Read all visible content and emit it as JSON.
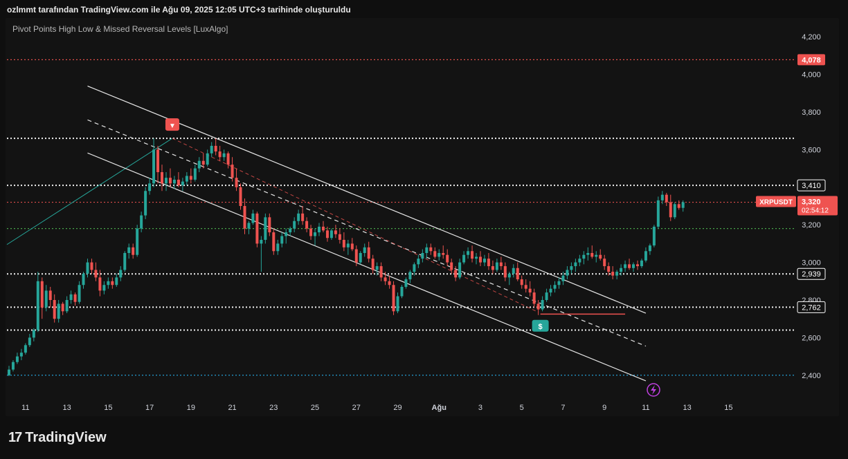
{
  "header": {
    "caption": "ozlmmt tarafından TradingView.com ile Ağu 09, 2025 12:05 UTC+3 tarihinde oluşturuldu"
  },
  "indicator": {
    "title": "Pivot Points High Low & Missed Reversal Levels [LuxAlgo]"
  },
  "footer": {
    "brand": "TradingView"
  },
  "colors": {
    "background": "#131313",
    "up": "#26a69a",
    "down": "#ef5350",
    "channel": "#e6e6e6",
    "pivot_high_marker": "#ef5350",
    "pivot_low_marker": "#26a69a",
    "red_level": "#ef5350",
    "green_level": "#4caf50",
    "blue_level": "#29b6f6",
    "purple_icon": "#c040e0"
  },
  "chart_data": {
    "type": "candlestick",
    "symbol": "XRPUSDT",
    "x_ticks": [
      "11",
      "13",
      "15",
      "17",
      "19",
      "21",
      "23",
      "25",
      "27",
      "29",
      "Ağu",
      "3",
      "5",
      "7",
      "9",
      "11",
      "13",
      "15"
    ],
    "y_ticks": [
      "4,200",
      "4,000",
      "3,800",
      "3,600",
      "3,200",
      "3,000",
      "2,800",
      "2,600",
      "2,400"
    ],
    "y_range": [
      2300,
      4300
    ],
    "x_range": [
      10.1,
      48.1
    ],
    "levels": [
      {
        "value": 4078,
        "label": "4,078",
        "style": "dotted",
        "color": "#ef5350",
        "tag": "filled-red"
      },
      {
        "value": 3660,
        "label": "",
        "style": "dotted",
        "color": "#ffffff",
        "tag": ""
      },
      {
        "value": 3410,
        "label": "3,410",
        "style": "dotted",
        "color": "#ffffff",
        "tag": "outlined"
      },
      {
        "value": 3320,
        "label": "",
        "style": "dotted",
        "color": "#ef5350",
        "tag": ""
      },
      {
        "value": 3180,
        "label": "",
        "style": "dotted",
        "color": "#4caf50",
        "tag": ""
      },
      {
        "value": 2939,
        "label": "2,939",
        "style": "dotted",
        "color": "#ffffff",
        "tag": "outlined"
      },
      {
        "value": 2762,
        "label": "2,762",
        "style": "dotted",
        "color": "#ffffff",
        "tag": "outlined"
      },
      {
        "value": 2640,
        "label": "",
        "style": "dotted",
        "color": "#ffffff",
        "tag": ""
      },
      {
        "value": 2400,
        "label": "",
        "style": "dotted",
        "color": "#29b6f6",
        "tag": ""
      }
    ],
    "price_tag": {
      "symbol": "XRPUSDT",
      "price": "3,320",
      "countdown": "02:54:12",
      "value": 3320
    },
    "channel": {
      "upper": [
        [
          14.0,
          3938
        ],
        [
          41.0,
          2730
        ]
      ],
      "middle": [
        [
          14.0,
          3758
        ],
        [
          41.0,
          2555
        ]
      ],
      "lower": [
        [
          14.0,
          3582
        ],
        [
          41.0,
          2370
        ]
      ]
    },
    "trend_line": [
      [
        10.1,
        3095
      ],
      [
        18.1,
        3660
      ]
    ],
    "red_dashed": [
      [
        18.1,
        3660
      ],
      [
        35.8,
        2735
      ]
    ],
    "support_segment": {
      "x": [
        35.9,
        40.0
      ],
      "value": 2725
    },
    "pivot_high": {
      "x": 18.1,
      "value": 3660,
      "label": "▼"
    },
    "pivot_low": {
      "x": 35.9,
      "value": 2720,
      "label": "$"
    },
    "candles": [
      [
        10.2,
        2400,
        2450,
        2395,
        2430
      ],
      [
        10.4,
        2430,
        2480,
        2420,
        2470
      ],
      [
        10.6,
        2470,
        2520,
        2460,
        2500
      ],
      [
        10.8,
        2500,
        2540,
        2480,
        2520
      ],
      [
        11.0,
        2520,
        2570,
        2510,
        2560
      ],
      [
        11.2,
        2560,
        2620,
        2550,
        2600
      ],
      [
        11.4,
        2600,
        2650,
        2580,
        2640
      ],
      [
        11.6,
        2640,
        2950,
        2630,
        2900
      ],
      [
        11.8,
        2900,
        2920,
        2700,
        2760
      ],
      [
        12.0,
        2760,
        2880,
        2740,
        2850
      ],
      [
        12.2,
        2850,
        2870,
        2760,
        2800
      ],
      [
        12.4,
        2800,
        2830,
        2680,
        2700
      ],
      [
        12.6,
        2700,
        2800,
        2680,
        2780
      ],
      [
        12.8,
        2780,
        2790,
        2720,
        2740
      ],
      [
        13.0,
        2740,
        2820,
        2730,
        2800
      ],
      [
        13.2,
        2800,
        2850,
        2780,
        2830
      ],
      [
        13.4,
        2830,
        2840,
        2770,
        2790
      ],
      [
        13.6,
        2790,
        2900,
        2780,
        2880
      ],
      [
        13.8,
        2880,
        2950,
        2860,
        2940
      ],
      [
        14.0,
        2940,
        3020,
        2920,
        3000
      ],
      [
        14.2,
        3000,
        3020,
        2940,
        2960
      ],
      [
        14.4,
        2960,
        3000,
        2900,
        2920
      ],
      [
        14.6,
        2920,
        2960,
        2820,
        2850
      ],
      [
        14.8,
        2850,
        2900,
        2830,
        2880
      ],
      [
        15.0,
        2880,
        2920,
        2860,
        2900
      ],
      [
        15.2,
        2900,
        2920,
        2860,
        2880
      ],
      [
        15.4,
        2880,
        2940,
        2870,
        2920
      ],
      [
        15.6,
        2920,
        2980,
        2900,
        2960
      ],
      [
        15.8,
        2960,
        3060,
        2950,
        3050
      ],
      [
        16.0,
        3050,
        3100,
        3020,
        3080
      ],
      [
        16.2,
        3080,
        3100,
        3020,
        3040
      ],
      [
        16.4,
        3040,
        3200,
        3030,
        3180
      ],
      [
        16.6,
        3180,
        3270,
        3160,
        3250
      ],
      [
        16.8,
        3250,
        3400,
        3230,
        3380
      ],
      [
        17.0,
        3380,
        3450,
        3360,
        3420
      ],
      [
        17.2,
        3420,
        3660,
        3400,
        3600
      ],
      [
        17.4,
        3600,
        3620,
        3420,
        3480
      ],
      [
        17.6,
        3480,
        3520,
        3380,
        3420
      ],
      [
        17.8,
        3420,
        3480,
        3380,
        3450
      ],
      [
        18.0,
        3450,
        3500,
        3400,
        3420
      ],
      [
        18.2,
        3420,
        3460,
        3390,
        3440
      ],
      [
        18.4,
        3440,
        3480,
        3400,
        3410
      ],
      [
        18.6,
        3410,
        3450,
        3380,
        3430
      ],
      [
        18.8,
        3430,
        3480,
        3410,
        3460
      ],
      [
        19.0,
        3460,
        3500,
        3420,
        3440
      ],
      [
        19.2,
        3440,
        3520,
        3430,
        3500
      ],
      [
        19.4,
        3500,
        3560,
        3480,
        3540
      ],
      [
        19.6,
        3540,
        3580,
        3500,
        3520
      ],
      [
        19.8,
        3520,
        3600,
        3510,
        3580
      ],
      [
        20.0,
        3580,
        3640,
        3560,
        3620
      ],
      [
        20.2,
        3620,
        3660,
        3570,
        3590
      ],
      [
        20.4,
        3590,
        3620,
        3540,
        3560
      ],
      [
        20.6,
        3560,
        3600,
        3540,
        3580
      ],
      [
        20.8,
        3580,
        3590,
        3500,
        3520
      ],
      [
        21.0,
        3520,
        3560,
        3430,
        3450
      ],
      [
        21.2,
        3450,
        3500,
        3380,
        3400
      ],
      [
        21.4,
        3400,
        3420,
        3280,
        3300
      ],
      [
        21.6,
        3300,
        3340,
        3150,
        3180
      ],
      [
        21.8,
        3180,
        3220,
        3150,
        3210
      ],
      [
        22.0,
        3210,
        3280,
        3200,
        3260
      ],
      [
        22.2,
        3260,
        3270,
        3080,
        3100
      ],
      [
        22.4,
        3100,
        3140,
        2950,
        3120
      ],
      [
        22.6,
        3120,
        3260,
        3100,
        3240
      ],
      [
        22.8,
        3240,
        3260,
        3140,
        3160
      ],
      [
        23.0,
        3160,
        3180,
        3040,
        3060
      ],
      [
        23.2,
        3060,
        3120,
        3040,
        3100
      ],
      [
        23.4,
        3100,
        3160,
        3080,
        3140
      ],
      [
        23.6,
        3140,
        3180,
        3100,
        3160
      ],
      [
        23.8,
        3160,
        3190,
        3140,
        3180
      ],
      [
        24.0,
        3180,
        3240,
        3160,
        3220
      ],
      [
        24.2,
        3220,
        3280,
        3200,
        3260
      ],
      [
        24.4,
        3260,
        3300,
        3200,
        3220
      ],
      [
        24.6,
        3220,
        3240,
        3160,
        3180
      ],
      [
        24.8,
        3180,
        3200,
        3120,
        3140
      ],
      [
        25.0,
        3140,
        3180,
        3090,
        3160
      ],
      [
        25.2,
        3160,
        3210,
        3140,
        3190
      ],
      [
        25.4,
        3190,
        3220,
        3160,
        3170
      ],
      [
        25.6,
        3170,
        3190,
        3110,
        3130
      ],
      [
        25.8,
        3130,
        3180,
        3120,
        3170
      ],
      [
        26.0,
        3170,
        3200,
        3130,
        3150
      ],
      [
        26.2,
        3150,
        3180,
        3100,
        3120
      ],
      [
        26.4,
        3120,
        3160,
        3060,
        3080
      ],
      [
        26.6,
        3080,
        3120,
        3040,
        3100
      ],
      [
        26.8,
        3100,
        3130,
        3060,
        3070
      ],
      [
        27.0,
        3070,
        3090,
        2980,
        3000
      ],
      [
        27.2,
        3000,
        3060,
        2990,
        3050
      ],
      [
        27.4,
        3050,
        3100,
        3030,
        3080
      ],
      [
        27.6,
        3080,
        3110,
        3000,
        3020
      ],
      [
        27.8,
        3020,
        3040,
        2940,
        2960
      ],
      [
        28.0,
        2960,
        3000,
        2930,
        2980
      ],
      [
        28.2,
        2980,
        3000,
        2900,
        2920
      ],
      [
        28.4,
        2920,
        2950,
        2880,
        2900
      ],
      [
        28.6,
        2900,
        2930,
        2860,
        2880
      ],
      [
        28.8,
        2880,
        2900,
        2720,
        2740
      ],
      [
        29.0,
        2740,
        2840,
        2730,
        2820
      ],
      [
        29.2,
        2820,
        2880,
        2810,
        2870
      ],
      [
        29.4,
        2870,
        2920,
        2860,
        2910
      ],
      [
        29.6,
        2910,
        2960,
        2890,
        2950
      ],
      [
        29.8,
        2950,
        3000,
        2930,
        2990
      ],
      [
        30.0,
        2990,
        3040,
        2970,
        3020
      ],
      [
        30.2,
        3020,
        3070,
        3000,
        3050
      ],
      [
        30.4,
        3050,
        3100,
        3020,
        3080
      ],
      [
        30.6,
        3080,
        3100,
        3040,
        3060
      ],
      [
        30.8,
        3060,
        3080,
        3020,
        3030
      ],
      [
        31.0,
        3030,
        3070,
        3010,
        3050
      ],
      [
        31.2,
        3050,
        3090,
        3020,
        3040
      ],
      [
        31.4,
        3040,
        3070,
        2980,
        3000
      ],
      [
        31.6,
        3000,
        3020,
        2940,
        2960
      ],
      [
        31.8,
        2960,
        2980,
        2900,
        2920
      ],
      [
        32.0,
        2920,
        3020,
        2910,
        3000
      ],
      [
        32.2,
        3000,
        3060,
        2990,
        3040
      ],
      [
        32.4,
        3040,
        3080,
        3020,
        3060
      ],
      [
        32.6,
        3060,
        3090,
        3000,
        3020
      ],
      [
        32.8,
        3020,
        3050,
        2990,
        3030
      ],
      [
        33.0,
        3030,
        3060,
        2980,
        3000
      ],
      [
        33.2,
        3000,
        3040,
        2980,
        3020
      ],
      [
        33.4,
        3020,
        3050,
        2960,
        2980
      ],
      [
        33.6,
        2980,
        3010,
        2940,
        2960
      ],
      [
        33.8,
        2960,
        3020,
        2950,
        3000
      ],
      [
        34.0,
        3000,
        3030,
        2960,
        2980
      ],
      [
        34.2,
        2980,
        3000,
        2900,
        2920
      ],
      [
        34.4,
        2920,
        2950,
        2880,
        2940
      ],
      [
        34.6,
        2940,
        2990,
        2920,
        2970
      ],
      [
        34.8,
        2970,
        3000,
        2900,
        2910
      ],
      [
        35.0,
        2910,
        2930,
        2860,
        2880
      ],
      [
        35.2,
        2880,
        2910,
        2840,
        2860
      ],
      [
        35.4,
        2860,
        2900,
        2820,
        2840
      ],
      [
        35.6,
        2840,
        2860,
        2760,
        2780
      ],
      [
        35.8,
        2780,
        2800,
        2720,
        2750
      ],
      [
        36.0,
        2750,
        2820,
        2740,
        2800
      ],
      [
        36.2,
        2800,
        2860,
        2790,
        2840
      ],
      [
        36.4,
        2840,
        2880,
        2820,
        2860
      ],
      [
        36.6,
        2860,
        2900,
        2840,
        2880
      ],
      [
        36.8,
        2880,
        2920,
        2860,
        2900
      ],
      [
        37.0,
        2900,
        2950,
        2880,
        2930
      ],
      [
        37.2,
        2930,
        2980,
        2910,
        2960
      ],
      [
        37.4,
        2960,
        3000,
        2940,
        2980
      ],
      [
        37.6,
        2980,
        3020,
        2950,
        3000
      ],
      [
        37.8,
        3000,
        3040,
        2980,
        3020
      ],
      [
        38.0,
        3020,
        3060,
        2990,
        3040
      ],
      [
        38.2,
        3040,
        3080,
        3010,
        3050
      ],
      [
        38.4,
        3050,
        3090,
        3020,
        3030
      ],
      [
        38.6,
        3030,
        3060,
        3000,
        3040
      ],
      [
        38.8,
        3040,
        3070,
        3010,
        3020
      ],
      [
        39.0,
        3020,
        3040,
        2960,
        2980
      ],
      [
        39.2,
        2980,
        3000,
        2930,
        2950
      ],
      [
        39.4,
        2950,
        2980,
        2910,
        2930
      ],
      [
        39.6,
        2930,
        2960,
        2910,
        2950
      ],
      [
        39.8,
        2950,
        2990,
        2930,
        2970
      ],
      [
        40.0,
        2970,
        3010,
        2950,
        2990
      ],
      [
        40.2,
        2990,
        3020,
        2960,
        2970
      ],
      [
        40.4,
        2970,
        3000,
        2950,
        2990
      ],
      [
        40.6,
        2990,
        3010,
        2960,
        2980
      ],
      [
        40.8,
        2980,
        3020,
        2970,
        3010
      ],
      [
        41.0,
        3010,
        3080,
        3000,
        3060
      ],
      [
        41.2,
        3060,
        3100,
        3040,
        3090
      ],
      [
        41.4,
        3090,
        3200,
        3080,
        3190
      ],
      [
        41.6,
        3190,
        3350,
        3180,
        3330
      ],
      [
        41.8,
        3330,
        3380,
        3310,
        3360
      ],
      [
        42.0,
        3360,
        3370,
        3300,
        3320
      ],
      [
        42.2,
        3320,
        3360,
        3220,
        3240
      ],
      [
        42.4,
        3240,
        3320,
        3230,
        3310
      ],
      [
        42.6,
        3310,
        3330,
        3280,
        3290
      ],
      [
        42.8,
        3290,
        3330,
        3270,
        3320
      ]
    ]
  }
}
